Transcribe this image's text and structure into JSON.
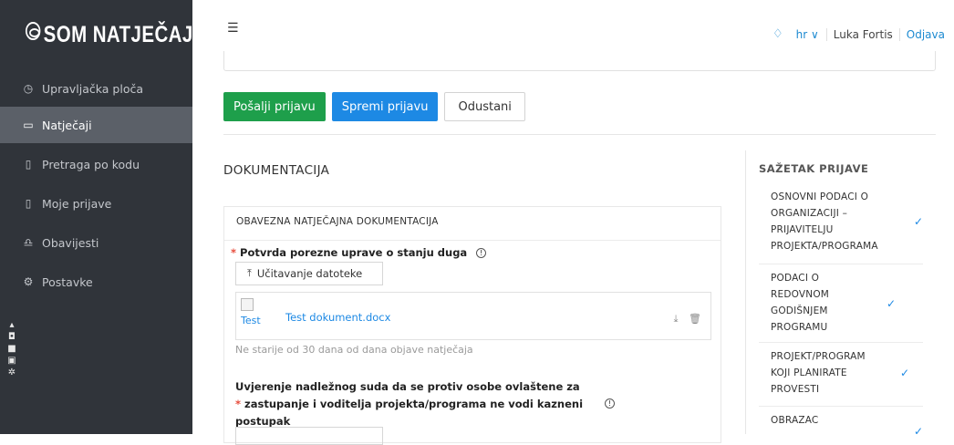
{
  "brand": {
    "logo_text": "SOM NATJEČAJI"
  },
  "sidebar": {
    "items": [
      {
        "label": "Upravljačka ploča",
        "icon": "dashboard-icon",
        "glyph": "◷"
      },
      {
        "label": "Natječaji",
        "icon": "folder-icon",
        "glyph": "▭"
      },
      {
        "label": "Pretraga po kodu",
        "icon": "document-icon",
        "glyph": "▯"
      },
      {
        "label": "Moje prijave",
        "icon": "file-icon",
        "glyph": "▯"
      },
      {
        "label": "Obavijesti",
        "icon": "bell-icon",
        "glyph": "♎"
      },
      {
        "label": "Postavke",
        "icon": "gear-icon",
        "glyph": "⚙"
      }
    ],
    "active_index": 1
  },
  "header": {
    "menu_glyph": "☰",
    "bell_glyph": "🔔",
    "language": "hr ∨",
    "user_name": "Luka Fortis",
    "logout": "Odjava"
  },
  "actions": {
    "submit": "Pošalji prijavu",
    "save": "Spremi prijavu",
    "cancel": "Odustani"
  },
  "documentation": {
    "title": "DOKUMENTACIJA",
    "card_header": "OBAVEZNA NATJEČAJNA DOKUMENTACIJA",
    "field1": {
      "required_mark": "*",
      "label": "Potvrda porezne uprave o stanju duga",
      "upload_label": "Učitavanje datoteke",
      "file_thumb_alt": "Test",
      "file_name": "Test dokument.docx",
      "hint": "Ne starije od 30 dana od dana objave natječaja"
    },
    "field2": {
      "required_mark": "*",
      "line1": "Uvjerenje nadležnog suda da se protiv osobe ovlaštene za",
      "line2": "zastupanje i voditelja projekta/programa ne vodi kazneni",
      "line3": "postupak"
    }
  },
  "summary": {
    "title": "SAŽETAK PRIJAVE",
    "items": [
      {
        "lines": [
          "OSNOVNI PODACI O",
          "ORGANIZACIJI –",
          "PRIJAVITELJU",
          "PROJEKTA/PROGRAMA"
        ],
        "checked": true
      },
      {
        "lines": [
          "PODACI O",
          "REDOVNOM",
          "GODIŠNJEM",
          "PROGRAMU"
        ],
        "checked": true
      },
      {
        "lines": [
          "PROJEKT/PROGRAM",
          "KOJI PLANIRATE",
          "PROVESTI"
        ],
        "checked": true
      },
      {
        "lines": [
          "OBRAZAC"
        ],
        "checked": true
      }
    ]
  },
  "colors": {
    "sidebar_bg": "#30343a",
    "sidebar_active": "#5b6068",
    "primary_blue": "#1d89e4",
    "success_green": "#1e9f4b",
    "required_red": "#e74c3c"
  }
}
